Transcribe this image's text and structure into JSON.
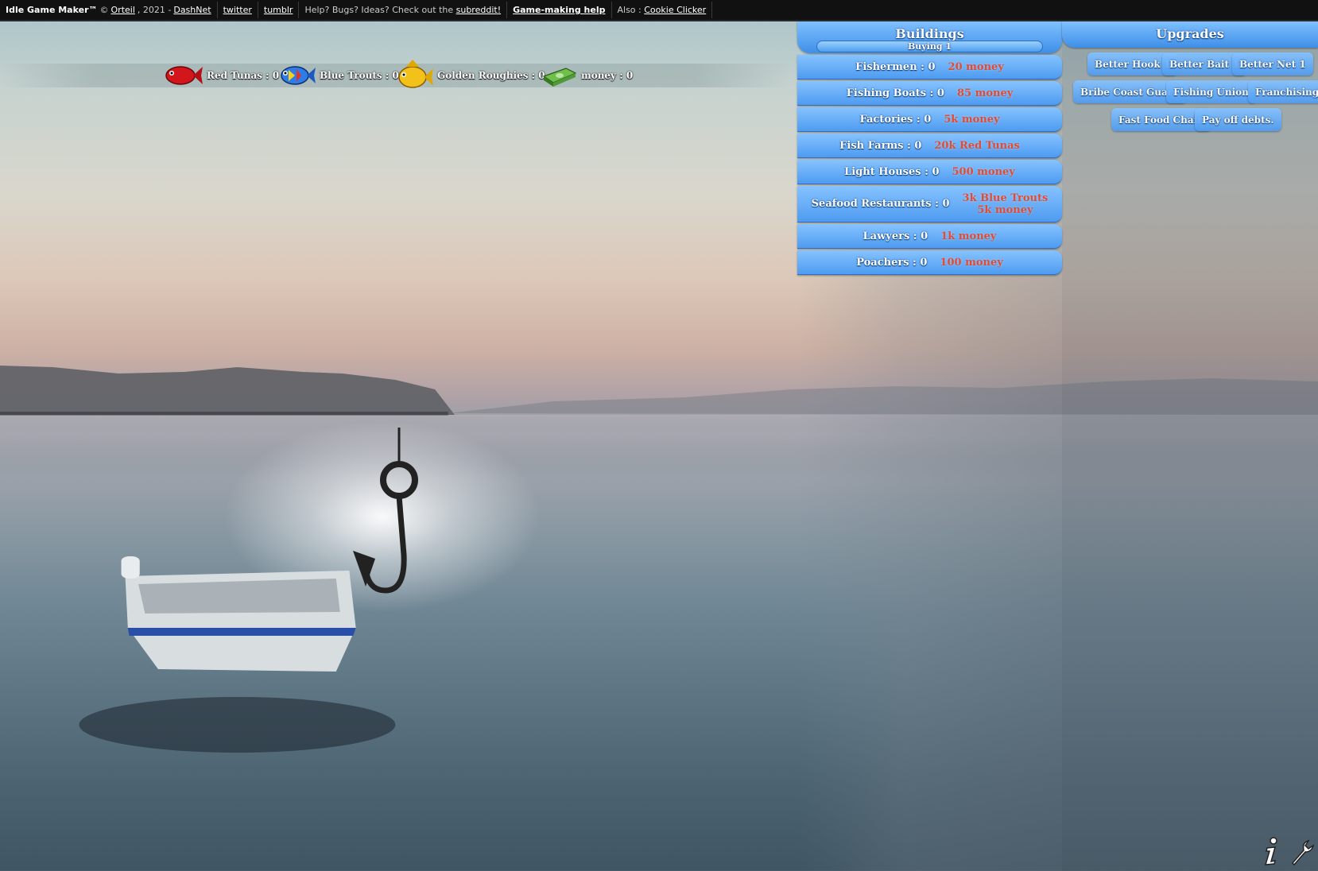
{
  "topbar": {
    "brand": "Idle Game Maker™",
    "copyright_prefix": "©",
    "author_link": "Orteil",
    "year": ", 2021 -",
    "company_link": "DashNet",
    "twitter_link": "twitter",
    "tumblr_link": "tumblr",
    "help_text": "Help? Bugs? Ideas? Check out the",
    "subreddit_link": "subreddit!",
    "game_help_link": "Game-making help",
    "also_text": "Also :",
    "cookie_clicker_link": "Cookie Clicker"
  },
  "resources": [
    {
      "label": "Red Tunas : 0",
      "icon": "red-fish-icon",
      "color": "#d2161c"
    },
    {
      "label": "Blue Trouts : 0",
      "icon": "blue-fish-icon",
      "color": "#2f7ce8"
    },
    {
      "label": "Golden Roughies : 0",
      "icon": "golden-fish-icon",
      "color": "#f2c21a"
    },
    {
      "label": "money : 0",
      "icon": "money-icon",
      "color": "#4f9a3a"
    }
  ],
  "buildings": {
    "title": "Buildings",
    "buying": "Buying 1",
    "items": [
      {
        "name": "Fishermen : 0",
        "cost": "20 money"
      },
      {
        "name": "Fishing Boats : 0",
        "cost": "85 money"
      },
      {
        "name": "Factories : 0",
        "cost": "5k money"
      },
      {
        "name": "Fish Farms : 0",
        "cost": "20k Red Tunas"
      },
      {
        "name": "Light Houses : 0",
        "cost": "500 money"
      },
      {
        "name": "Seafood Restaurants : 0",
        "cost": "3k Blue Trouts",
        "cost2": "5k money"
      },
      {
        "name": "Lawyers : 0",
        "cost": "1k money"
      },
      {
        "name": "Poachers : 0",
        "cost": "100 money"
      }
    ]
  },
  "upgrades": {
    "title": "Upgrades",
    "items": [
      {
        "label": "Better Hook 1"
      },
      {
        "label": "Better Bait 1"
      },
      {
        "label": "Better Net 1"
      },
      {
        "label": "Bribe Coast Guard"
      },
      {
        "label": "Fishing Union"
      },
      {
        "label": "Franchising"
      },
      {
        "label": "Fast Food Chain"
      },
      {
        "label": "Pay off debts."
      }
    ]
  },
  "corner_icons": [
    "info-icon",
    "settings-wrench-icon"
  ],
  "colors": {
    "button_top": "#86c3ff",
    "button_bottom": "#4e9bf0",
    "cost_text": "#e34a2f",
    "topbar_bg": "#111111"
  }
}
